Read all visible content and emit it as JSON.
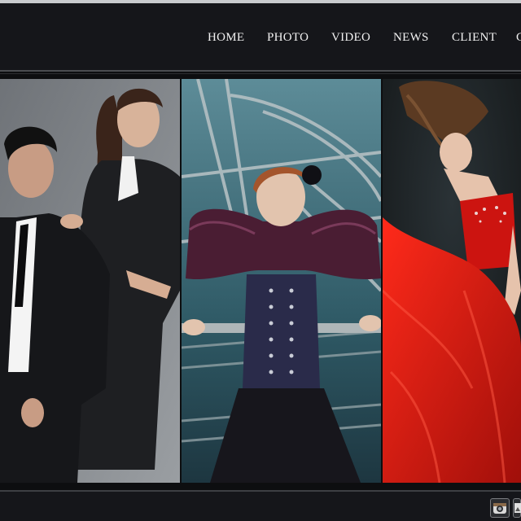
{
  "nav": {
    "items": [
      {
        "label": "HOME"
      },
      {
        "label": "PHOTO"
      },
      {
        "label": "VIDEO"
      },
      {
        "label": "NEWS"
      },
      {
        "label": "CLIENT"
      }
    ]
  },
  "gallery": {
    "photos": [
      {
        "subject": "couple in black suits"
      },
      {
        "subject": "model in corset under ferris wheel"
      },
      {
        "subject": "model in red gown"
      }
    ]
  },
  "footer": {
    "social": [
      {
        "icon": "instagram-icon"
      },
      {
        "icon": "photo-app-icon"
      }
    ]
  },
  "colors": {
    "background": "#0d0e10",
    "nav_background": "#15161a",
    "nav_text": "#f2f2f2",
    "accent_red": "#d0160f"
  }
}
